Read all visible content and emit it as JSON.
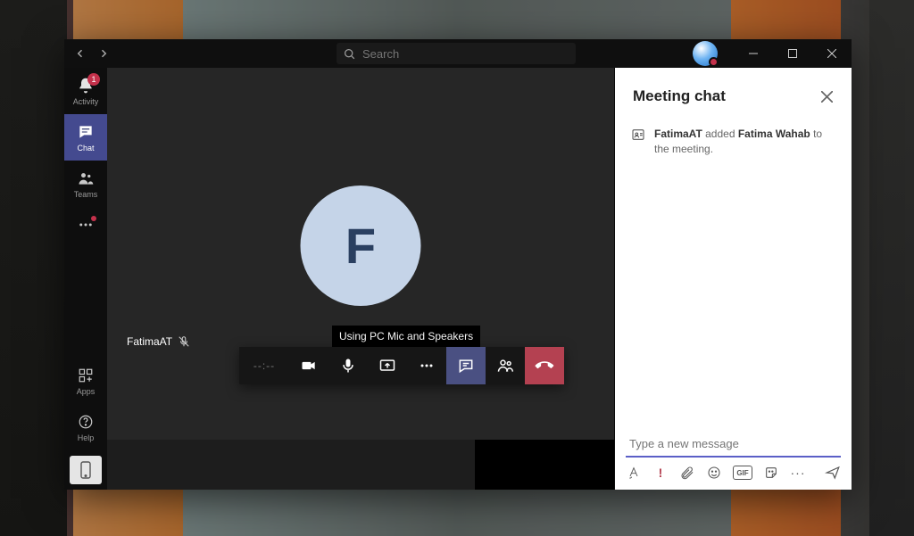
{
  "titlebar": {
    "search_placeholder": "Search"
  },
  "sidebar": {
    "activity_label": "Activity",
    "activity_badge": "1",
    "chat_label": "Chat",
    "teams_label": "Teams",
    "apps_label": "Apps",
    "help_label": "Help"
  },
  "call": {
    "avatar_initial": "F",
    "participant_name": "FatimaAT",
    "timer_text": "--:--",
    "tooltip_text": "Using PC Mic and Speakers"
  },
  "chat": {
    "title": "Meeting chat",
    "system_message": {
      "actor": "FatimaAT",
      "verb": " added ",
      "subject": "Fatima Wahab",
      "suffix": " to the meeting."
    },
    "input_placeholder": "Type a new message",
    "tools": {
      "priority_glyph": "!",
      "gif_glyph": "GIF",
      "more_glyph": "···"
    }
  }
}
